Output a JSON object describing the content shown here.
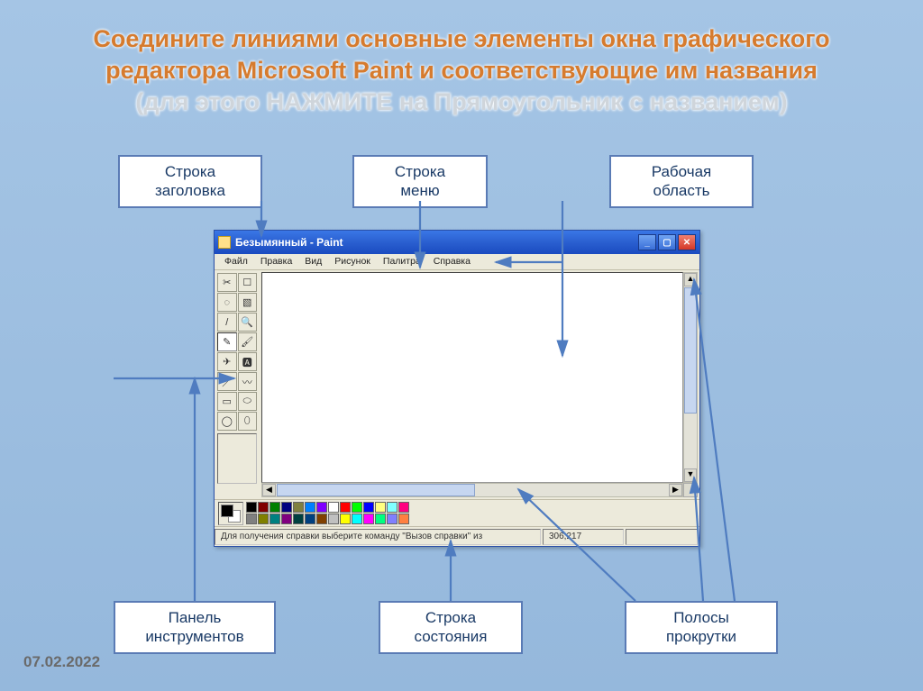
{
  "title_line1": "Соедините линиями основные элементы окна графического редактора Microsoft Paint и соответствующие им названия",
  "title_line2": "(для этого НАЖМИТЕ на Прямоугольник с названием)",
  "date": "07.02.2022",
  "labels": {
    "title_bar": "Строка\nзаголовка",
    "menu_bar": "Строка\nменю",
    "work_area": "Рабочая\nобласть",
    "toolbox": "Панель\nинструментов",
    "status_bar": "Строка\nсостояния",
    "scrollbars": "Полосы\nпрокрутки"
  },
  "paint": {
    "window_title": "Безымянный - Paint",
    "menu": [
      "Файл",
      "Правка",
      "Вид",
      "Рисунок",
      "Палитра",
      "Справка"
    ],
    "status_text": "Для получения справки выберите команду \"Вызов справки\" из",
    "coords": "306,217",
    "palette": [
      "#000000",
      "#808080",
      "#800000",
      "#808000",
      "#008000",
      "#008080",
      "#000080",
      "#800080",
      "#808040",
      "#004040",
      "#0080ff",
      "#004080",
      "#8000ff",
      "#804000",
      "#ffffff",
      "#c0c0c0",
      "#ff0000",
      "#ffff00",
      "#00ff00",
      "#00ffff",
      "#0000ff",
      "#ff00ff",
      "#ffff80",
      "#00ff80",
      "#80ffff",
      "#8080ff",
      "#ff0080",
      "#ff8040"
    ],
    "tools": [
      "✂",
      "☐",
      "◌",
      "▧",
      "/",
      "🔍",
      "✎",
      "🖌",
      "✈",
      "🅰",
      "／",
      "〰",
      "▭",
      "⬭",
      "◯",
      "⬯"
    ]
  }
}
